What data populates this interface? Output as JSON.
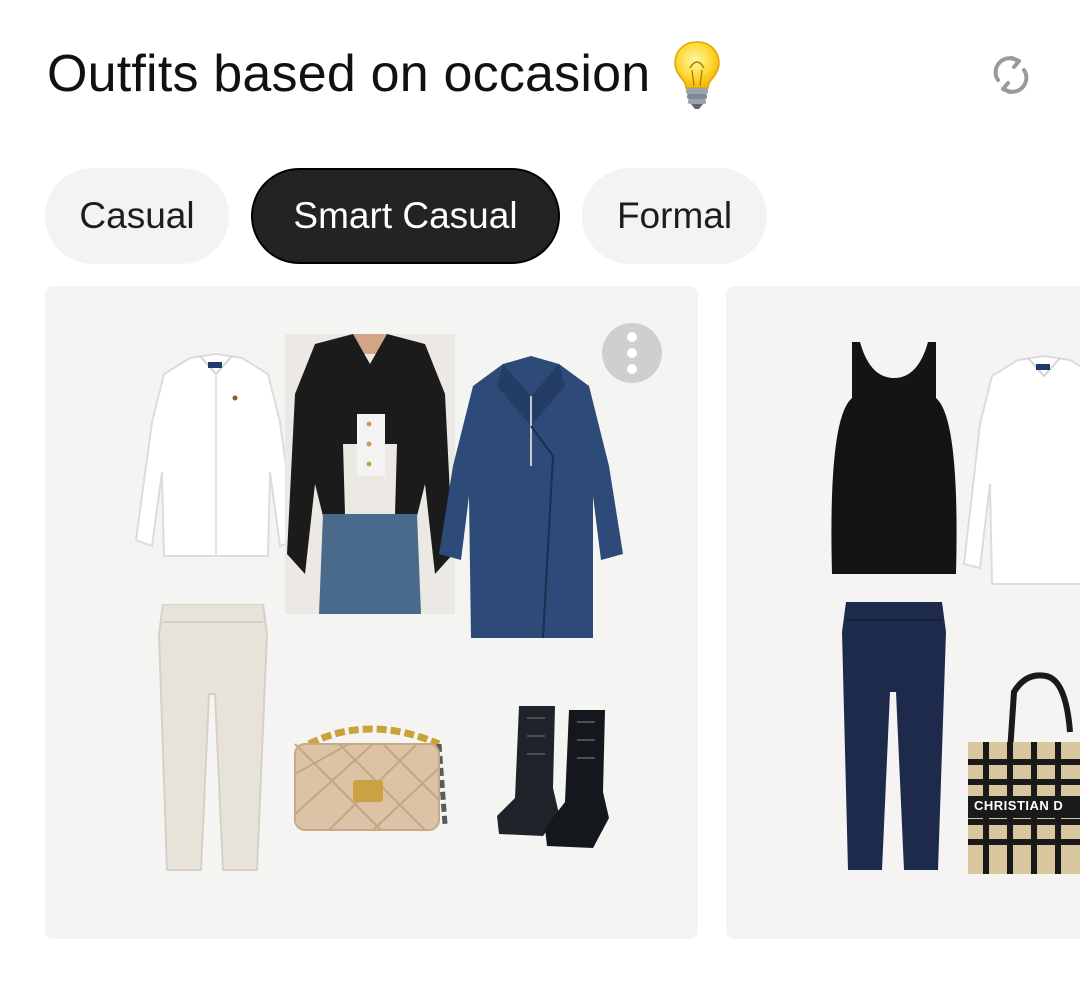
{
  "header": {
    "title": "Outfits based on occasion",
    "title_icon": "lightbulb-icon",
    "refresh_icon": "refresh-icon"
  },
  "tabs": [
    {
      "label": "Casual",
      "active": false
    },
    {
      "label": "Smart Casual",
      "active": true
    },
    {
      "label": "Formal",
      "active": false
    }
  ],
  "outfits": [
    {
      "items": [
        "white-shirt",
        "black-cardigan",
        "navy-wool-coat",
        "cream-trousers",
        "beige-quilted-bag",
        "black-lace-up-boots"
      ],
      "more_icon": "more-vertical-icon"
    },
    {
      "items": [
        "black-tank-top",
        "white-shirt",
        "navy-trousers",
        "tote-bag"
      ],
      "tote_label": "CHRISTIAN D"
    }
  ],
  "colors": {
    "active_tab_bg": "#232323",
    "inactive_tab_bg": "#f3f3f3",
    "card_bg": "#f4f4f2"
  }
}
